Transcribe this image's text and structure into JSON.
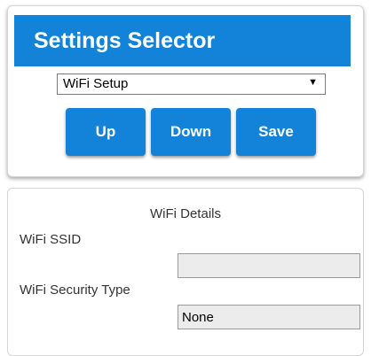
{
  "selector": {
    "title": "Settings Selector",
    "dropdown": {
      "selected": "WiFi Setup",
      "arrow_icon": "triangle-down-icon"
    },
    "buttons": {
      "up_label": "Up",
      "down_label": "Down",
      "save_label": "Save"
    }
  },
  "details": {
    "title": "WiFi Details",
    "fields": {
      "ssid_label": "WiFi SSID",
      "ssid_value": "",
      "security_label": "WiFi Security Type",
      "security_value": "None"
    }
  },
  "colors": {
    "accent": "#1283d8",
    "field_background": "#ececec"
  }
}
